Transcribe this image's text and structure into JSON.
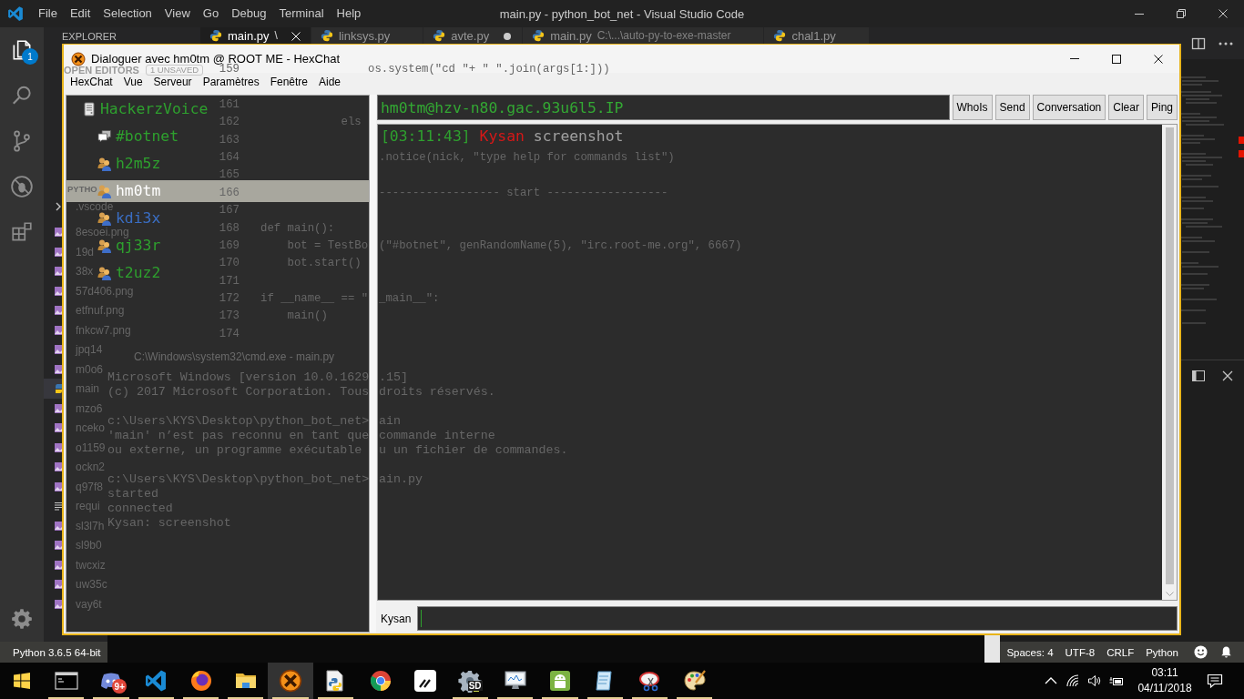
{
  "vscode": {
    "title_bar": {
      "menu": [
        "File",
        "Edit",
        "Selection",
        "View",
        "Go",
        "Debug",
        "Terminal",
        "Help"
      ],
      "title": "main.py - python_bot_net - Visual Studio Code"
    },
    "activity_bar": {
      "badge": "1"
    },
    "sidebar": {
      "header": "EXPLORER",
      "open_editors": {
        "title": "OPEN EDITORS",
        "badge": "1 UNSAVED"
      },
      "folder": "PYTHO",
      "files": [
        {
          "name": ".vscode",
          "kind": "folder",
          "selected": false
        },
        {
          "name": "8esoei.png",
          "kind": "image",
          "selected": false
        },
        {
          "name": "19d",
          "kind": "image",
          "selected": false
        },
        {
          "name": "38x",
          "kind": "image",
          "selected": false
        },
        {
          "name": "57d406.png",
          "kind": "image",
          "selected": false
        },
        {
          "name": "etfnuf.png",
          "kind": "image",
          "selected": false
        },
        {
          "name": "fnkcw7.png",
          "kind": "image",
          "selected": false
        },
        {
          "name": "jpq14",
          "kind": "image",
          "selected": false
        },
        {
          "name": "m0o6",
          "kind": "image",
          "selected": false
        },
        {
          "name": "main",
          "kind": "python",
          "selected": true
        },
        {
          "name": "mzo6",
          "kind": "image",
          "selected": false
        },
        {
          "name": "nceko",
          "kind": "image",
          "selected": false
        },
        {
          "name": "o1159",
          "kind": "image",
          "selected": false
        },
        {
          "name": "ockn2",
          "kind": "image",
          "selected": false
        },
        {
          "name": "q97f8",
          "kind": "image",
          "selected": false
        },
        {
          "name": "requi",
          "kind": "text",
          "selected": false
        },
        {
          "name": "sl3l7h",
          "kind": "image",
          "selected": false
        },
        {
          "name": "sl9b0",
          "kind": "image",
          "selected": false
        },
        {
          "name": "twcxiz",
          "kind": "image",
          "selected": false
        },
        {
          "name": "uw35c",
          "kind": "image",
          "selected": false
        },
        {
          "name": "vay6t",
          "kind": "image",
          "selected": false
        }
      ]
    },
    "tabs": [
      {
        "label": "main.py",
        "detail": "\\",
        "selected": true,
        "dirty": false
      },
      {
        "label": "linksys.py",
        "selected": false,
        "dirty": false
      },
      {
        "label": "avte.py",
        "selected": false,
        "dirty": true
      },
      {
        "label": "main.py",
        "detail": "C:\\...\\auto-py-to-exe-master",
        "selected": false,
        "dirty": false
      },
      {
        "label": "chal1.py",
        "selected": false,
        "dirty": false
      }
    ],
    "editor": {
      "lines": [
        {
          "number": "159",
          "code": "                os.system(\"cd \"+ \" \".join(args[1:]))"
        },
        {
          "number": "161"
        },
        {
          "number": "162",
          "code": "            els"
        },
        {
          "number": "163"
        },
        {
          "number": "164",
          "code_right": ".notice(nick, \"type help for commands list\")"
        },
        {
          "number": "165"
        },
        {
          "number": "166",
          "code_right": "------------------ start ------------------"
        },
        {
          "number": "167"
        },
        {
          "number": "168",
          "code": "def main():"
        },
        {
          "number": "169",
          "code": "    bot = TestBo",
          "code_right": "(\"#botnet\", genRandomName(5), \"irc.root-me.org\", 6667)"
        },
        {
          "number": "170",
          "code": "    bot.start()"
        },
        {
          "number": "171"
        },
        {
          "number": "172",
          "code": "if __name__ == \"",
          "code_right": "_main__\":"
        },
        {
          "number": "173",
          "code": "    main()"
        },
        {
          "number": "174"
        }
      ]
    },
    "status_bar": {
      "interpreter": "Python 3.6.5 64-bit",
      "items": [
        "Spaces: 4",
        "UTF-8",
        "CRLF",
        "Python"
      ]
    }
  },
  "console_window": {
    "title": "C:\\Windows\\system32\\cmd.exe - main.py",
    "blocks": [
      [
        {
          "left": "Microsoft Windows [version 10.0.1629",
          "right": ".15]"
        },
        {
          "left": "(c) 2017 Microsoft Corporation. Tous",
          "right": "droits réservés."
        }
      ],
      [
        {
          "left": "c:\\Users\\KYS\\Desktop\\python_bot_net>",
          "right": "ain"
        },
        {
          "left": "'main' n’est pas reconnu en tant que",
          "right": "commande interne"
        },
        {
          "left": "ou externe, un programme exécutable",
          "right": "u un fichier de commandes."
        }
      ],
      [
        {
          "left": "c:\\Users\\KYS\\Desktop\\python_bot_net>",
          "right": "ain.py"
        },
        {
          "left": "started"
        },
        {
          "left": "connected"
        },
        {
          "left": "Kysan: screenshot"
        }
      ]
    ]
  },
  "hexchat": {
    "title": "Dialoguer avec hm0tm @ ROOT ME - HexChat",
    "menu": [
      "HexChat",
      "Vue",
      "Serveur",
      "Paramètres",
      "Fenêtre",
      "Aide"
    ],
    "tree": [
      {
        "label": "HackerzVoice",
        "kind": "server",
        "color": "#2ea02e",
        "selected": false,
        "children": [
          {
            "label": "#botnet",
            "kind": "channel",
            "color": "#2ea02e",
            "selected": false
          },
          {
            "label": "h2m5z",
            "kind": "user",
            "color": "#2ea02e",
            "selected": false
          },
          {
            "label": "hm0tm",
            "kind": "user",
            "color": "#ffffff",
            "selected": true
          },
          {
            "label": "kdi3x",
            "kind": "user",
            "color": "#3a6ec4",
            "selected": false
          },
          {
            "label": "qj33r",
            "kind": "user",
            "color": "#2ea02e",
            "selected": false
          },
          {
            "label": "t2uz2",
            "kind": "user",
            "color": "#2ea02e",
            "selected": false
          }
        ]
      }
    ],
    "topic": "hm0tm@hzv-n80.gac.93u6l5.IP",
    "buttons": [
      "WhoIs",
      "Send",
      "Conversation",
      "Clear",
      "Ping"
    ],
    "messages": [
      {
        "time": "[03:11:43]",
        "nick": "Kysan",
        "text": "screenshot"
      }
    ],
    "nick": "Kysan"
  },
  "taskbar": {
    "apps": [
      {
        "kind": "console",
        "running": true,
        "active": false
      },
      {
        "kind": "chat",
        "badge": "9+",
        "running": true,
        "active": false
      },
      {
        "kind": "editor",
        "running": true,
        "active": false
      },
      {
        "kind": "firefox",
        "running": true,
        "active": false
      },
      {
        "kind": "folder",
        "running": true,
        "active": false
      },
      {
        "kind": "irc",
        "running": true,
        "active": true
      },
      {
        "kind": "installer",
        "running": true,
        "active": false
      },
      {
        "kind": "chrome",
        "running": false,
        "active": false
      },
      {
        "kind": "notes",
        "running": false,
        "active": false
      },
      {
        "kind": "settings",
        "label": "SD",
        "running": true,
        "active": false
      },
      {
        "kind": "monitor",
        "running": true,
        "active": false
      },
      {
        "kind": "android",
        "running": true,
        "active": false
      },
      {
        "kind": "notepad",
        "running": true,
        "active": false
      },
      {
        "kind": "snipping",
        "running": true,
        "active": false
      },
      {
        "kind": "paint",
        "running": true,
        "active": false
      }
    ],
    "clock": {
      "time": "03:11",
      "date": "04/11/2018"
    }
  }
}
